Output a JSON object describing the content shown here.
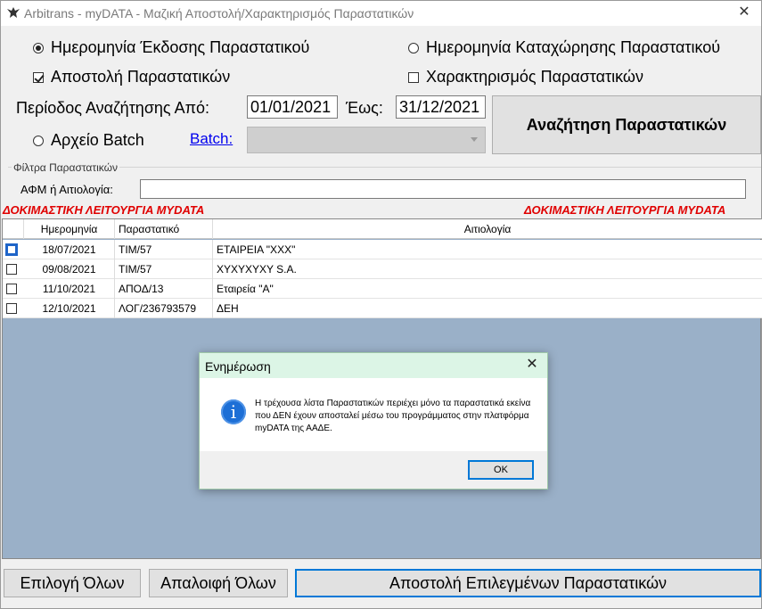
{
  "window": {
    "title": "Arbitrans - myDATA - Μαζική Αποστολή/Χαρακτηρισμός Παραστατικών",
    "app_icon": "eagle-icon",
    "close_glyph": "✕"
  },
  "options": {
    "date_issue": "Ημερομηνία Έκδοσης Παραστατικού",
    "date_entry": "Ημερομηνία Καταχώρησης Παραστατικού",
    "send_docs": "Αποστολή Παραστατικών",
    "classify_docs": "Χαρακτηρισμός Παραστατικών",
    "batch_file": "Αρχείο Batch"
  },
  "period": {
    "from_label": "Περίοδος Αναζήτησης Από:",
    "from_value": "01/01/2021",
    "to_label": "Έως:",
    "to_value": "31/12/2021"
  },
  "search_button": "Αναζήτηση Παραστατικών",
  "batch": {
    "link": "Batch:",
    "value": ""
  },
  "filter": {
    "group_title": "Φίλτρα Παραστατικών",
    "label": "ΑΦΜ ή Αιτιολογία:",
    "value": ""
  },
  "test_warning": "ΔΟΚΙΜΑΣΤΙΚΗ ΛΕΙΤΟΥΡΓΙΑ MYDATA",
  "grid": {
    "columns": [
      "Ημερομηνία",
      "Παραστατικό",
      "Αιτιολογία"
    ],
    "rows": [
      {
        "date": "18/07/2021",
        "doc": "ΤΙΜ/57",
        "reason": "ΕΤΑΙΡΕΙΑ \"ΧΧΧ\""
      },
      {
        "date": "09/08/2021",
        "doc": "ΤΙΜ/57",
        "reason": "ΧΥΧΥΧΥΧΥ S.A."
      },
      {
        "date": "11/10/2021",
        "doc": "ΑΠΟΔ/13",
        "reason": "Εταιρεία \"Α\""
      },
      {
        "date": "12/10/2021",
        "doc": "ΛΟΓ/236793579",
        "reason": "ΔΕΗ"
      }
    ]
  },
  "buttons": {
    "select_all": "Επιλογή Όλων",
    "deselect_all": "Απαλοιφή Όλων",
    "send_selected": "Αποστολή Επιλεγμένων Παραστατικών"
  },
  "dialog": {
    "title": "Ενημέρωση",
    "icon": "info-icon",
    "icon_glyph": "i",
    "message": "Η τρέχουσα λίστα Παραστατικών περιέχει μόνο τα παραστατικά εκείνα που ΔΕΝ έχουν αποσταλεί μέσω του προγράμματος στην πλατφόρμα myDATA της ΑΑΔΕ.",
    "ok": "OK"
  },
  "colors": {
    "grid_background": "#9ab0c8",
    "warning": "#e00000",
    "dialog_title": "#dcf5e6",
    "focus": "#0078d7"
  }
}
